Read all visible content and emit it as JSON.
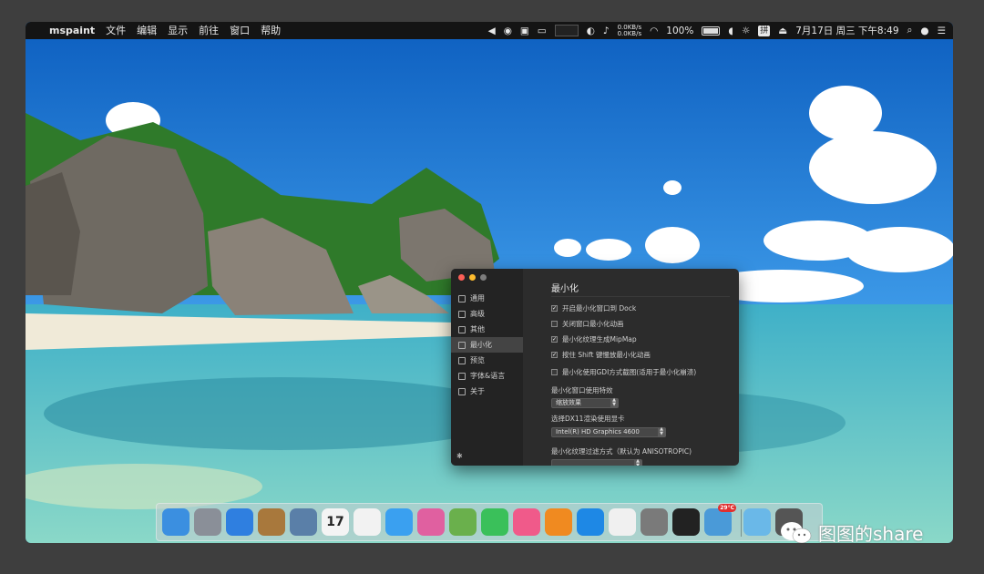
{
  "menubar": {
    "app_name": "mspaint",
    "menus": [
      "文件",
      "编辑",
      "显示",
      "前往",
      "窗口",
      "帮助"
    ],
    "net_up": "0.0KB/s",
    "net_down": "0.0KB/s",
    "battery": "100%",
    "input_method": "拼",
    "datetime": "7月17日 周三 下午8:49"
  },
  "prefs": {
    "sidebar": [
      {
        "label": "通用"
      },
      {
        "label": "高级"
      },
      {
        "label": "其他"
      },
      {
        "label": "最小化"
      },
      {
        "label": "预览"
      },
      {
        "label": "字体&语言"
      },
      {
        "label": "关于"
      }
    ],
    "selected": "最小化",
    "title": "最小化",
    "options": [
      {
        "label": "开启最小化窗口到 Dock",
        "checked": true
      },
      {
        "label": "关闭窗口最小化动画",
        "checked": false
      },
      {
        "label": "最小化纹理生成MipMap",
        "checked": true
      },
      {
        "label": "按住 Shift 键慢放最小化动画",
        "checked": true
      },
      {
        "label": "最小化使用GDI方式截图(适用于最小化崩溃)",
        "checked": false
      }
    ],
    "effect_label": "最小化窗口使用特效",
    "effect_value": "缩放效果",
    "gpu_label": "选择DX11渲染使用显卡",
    "gpu_value": "Intel(R) HD Graphics 4600",
    "filter_label": "最小化纹理过滤方式（默认为 ANISOTROPIC)"
  },
  "dock": {
    "items": [
      {
        "name": "finder",
        "color": "#3b8fe0"
      },
      {
        "name": "launchpad",
        "color": "#8a8f98"
      },
      {
        "name": "safari",
        "color": "#2f7fe0"
      },
      {
        "name": "notebook",
        "color": "#a8783c"
      },
      {
        "name": "preview",
        "color": "#5a7fa8"
      },
      {
        "name": "calendar",
        "color": "#f4f4f4",
        "text": "17"
      },
      {
        "name": "reminders",
        "color": "#f2f2f2"
      },
      {
        "name": "messages",
        "color": "#3aa0f0"
      },
      {
        "name": "game-center",
        "color": "#e060a0"
      },
      {
        "name": "maps",
        "color": "#6ab04c"
      },
      {
        "name": "facetime",
        "color": "#3ac05a"
      },
      {
        "name": "itunes",
        "color": "#f05a8a"
      },
      {
        "name": "ibooks",
        "color": "#f08a20"
      },
      {
        "name": "app-store",
        "color": "#1e88e5"
      },
      {
        "name": "photos",
        "color": "#f0f0f0"
      },
      {
        "name": "system-preferences",
        "color": "#7a7a7a"
      },
      {
        "name": "qq",
        "color": "#222222"
      },
      {
        "name": "weather",
        "color": "#4a9ad8",
        "badge": "29°C"
      },
      {
        "name": "downloads-folder",
        "color": "#6ab8e8"
      },
      {
        "name": "trash",
        "color": "#555555"
      }
    ]
  },
  "watermark": "图图的share"
}
